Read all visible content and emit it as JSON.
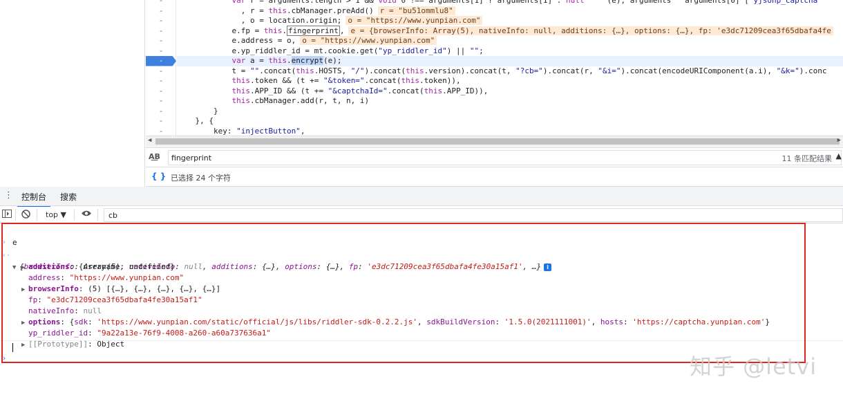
{
  "editor": {
    "gutter_marker": "-",
    "lines": [
      {
        "text": "var r = arguments.length > 1 && void 0 !== arguments[1] ? arguments[1] : null  \"\" (e), arguments   arguments[0] [\"yjsonp_captcha\"",
        "indent": "            "
      },
      {
        "text": "  , r = this.cbManager.preAdd()",
        "inline": "r = \"bu51ommlu8\"",
        "indent": "            "
      },
      {
        "text": "  , o = location.origin;",
        "inline": "o = \"https://www.yunpian.com\"",
        "indent": "            "
      },
      {
        "text": "e.fp = this.fingerprint,",
        "inline": "e = {browserInfo: Array(5), nativeInfo: null, additions: {…}, options: {…}, fp: 'e3dc71209cea3f65dbafa4fe",
        "indent": "            "
      },
      {
        "text": "e.address = o,",
        "inline": "o = \"https://www.yunpian.com\"",
        "indent": "            "
      },
      {
        "text": "e.yp_riddler_id = mt.cookie.get(\"yp_riddler_id\") || \"\";",
        "indent": "            "
      },
      {
        "text": "var a = this.encrypt(e);",
        "indent": "            "
      },
      {
        "text": "t = \"\".concat(this.HOSTS, \"/\").concat(this.version).concat(t, \"?cb=\").concat(r, \"&i=\").concat(encodeURIComponent(a.i), \"&k=\").conc",
        "indent": "            "
      },
      {
        "text": "this.token && (t += \"&token=\".concat(this.token)),",
        "indent": "            "
      },
      {
        "text": "this.APP_ID && (t += \"&captchaId=\".concat(this.APP_ID)),",
        "indent": "            "
      },
      {
        "text": "this.cbManager.add(r, t, n, i)",
        "indent": "            "
      },
      {
        "text": "}",
        "indent": "        "
      },
      {
        "text": "}, {",
        "indent": "    "
      },
      {
        "text": "key: \"injectButton\",",
        "indent": "        "
      },
      {
        "text": "",
        "indent": ""
      }
    ]
  },
  "search": {
    "case_icon": "A͟B",
    "query": "fingerprint",
    "match_count": "11 条匹配结果",
    "up_icon": "▲"
  },
  "status": {
    "braces_icon": "{ }",
    "selection": "已选择 24 个字符"
  },
  "drawer": {
    "menu_icon": "⋮",
    "tabs": [
      {
        "label": "控制台",
        "active": true
      },
      {
        "label": "搜索",
        "active": false
      }
    ]
  },
  "toolbar": {
    "context": "top ▼",
    "filter_value": "cb"
  },
  "console": {
    "input_expr": "e",
    "summary": {
      "open": "{",
      "browserInfo_key": "browserInfo",
      "browserInfo_val": "Array(5)",
      "nativeInfo_key": "nativeInfo",
      "nativeInfo_val": "null",
      "additions_key": "additions",
      "additions_val": "{…}",
      "options_key": "options",
      "options_val": "{…}",
      "fp_key": "fp",
      "fp_val": "'e3dc71209cea3f65dbafa4fe30a15af1'",
      "close": ", …}",
      "info": "i"
    },
    "props": {
      "additions_key": "additions",
      "additions_val": "{username: undefined}",
      "address_key": "address",
      "address_val": "\"https://www.yunpian.com\"",
      "browserInfo_key": "browserInfo",
      "browserInfo_val": "(5) [{…}, {…}, {…}, {…}, {…}]",
      "fp_key": "fp",
      "fp_val": "\"e3dc71209cea3f65dbafa4fe30a15af1\"",
      "nativeInfo_key": "nativeInfo",
      "nativeInfo_val": "null",
      "options_key": "options",
      "options_sdk": "'https://www.yunpian.com/static/official/js/libs/riddler-sdk-0.2.2.js'",
      "options_build": "'1.5.0(2021111001)'",
      "options_hosts": "'https://captcha.yunpian.com'",
      "yp_key": "yp_riddler_id",
      "yp_val": "\"9a22a13e-76f9-4008-a260-a60a737636a1\"",
      "proto_key": "[[Prototype]]",
      "proto_val": "Object"
    }
  },
  "watermark": "知乎 @letvi",
  "colors": {
    "highlight": "#3f7fe0",
    "annotation_box": "#e0231b"
  }
}
